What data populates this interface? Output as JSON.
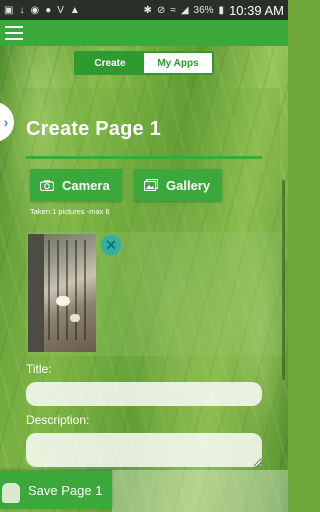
{
  "status_bar": {
    "battery": "36%",
    "time": "10:39 AM",
    "icons": [
      "image-icon",
      "usb-icon",
      "gamepad-icon",
      "messenger-icon",
      "v-icon",
      "wifi-boost-icon",
      "bluetooth-icon",
      "mute-icon",
      "wifi-icon",
      "signal-icon",
      "battery-icon"
    ]
  },
  "app_bar": {
    "menu_icon": "hamburger-menu-icon"
  },
  "tabs": [
    {
      "label": "Create",
      "active": true
    },
    {
      "label": "My Apps",
      "active": false
    }
  ],
  "page": {
    "title": "Create Page 1",
    "camera_label": "Camera",
    "gallery_label": "Gallery",
    "photo_info": "Taken 1 pictures -max 6",
    "title_label": "Title:",
    "title_value": "",
    "description_label": "Description:",
    "description_value": ""
  },
  "save": {
    "label": "Save Page 1"
  },
  "colors": {
    "accent": "#3aa83a",
    "remove": "#2fb1a6"
  }
}
